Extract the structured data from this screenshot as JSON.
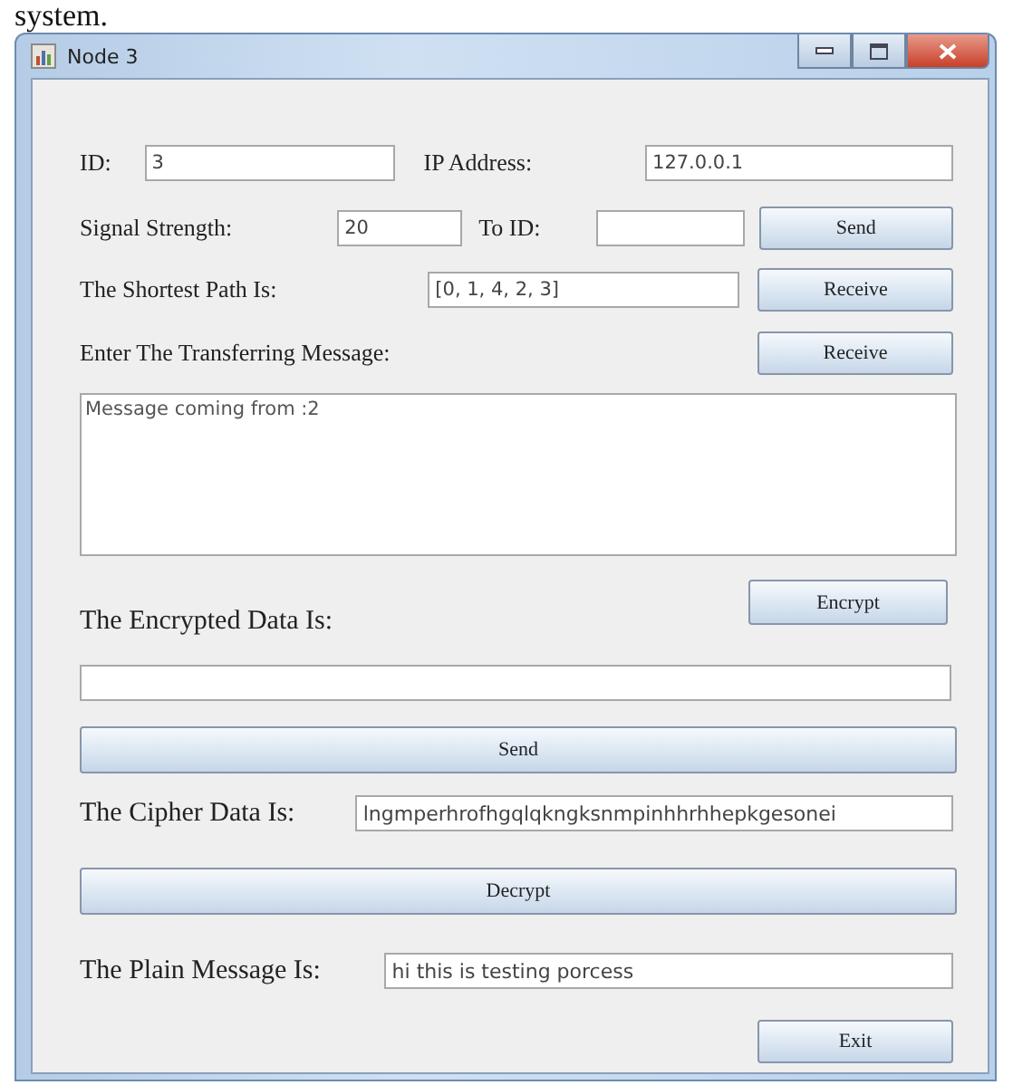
{
  "caption": "system.",
  "window": {
    "title": "Node 3"
  },
  "id": {
    "label": "ID:",
    "value": "3"
  },
  "ip_address": {
    "label": "IP Address:",
    "value": "127.0.0.1"
  },
  "signal_strength": {
    "label": "Signal Strength:",
    "value": "20"
  },
  "to_id": {
    "label": "To ID:"
  },
  "send_button": "Send",
  "shortest_path": {
    "label": "The Shortest Path Is:",
    "value": "[0, 1, 4, 2, 3]"
  },
  "receive_path_button": "Receive",
  "message": {
    "label": "Enter The Transferring Message:",
    "value": "Message coming from :2"
  },
  "receive_message_button": "Receive",
  "encrypt_button": "Encrypt",
  "encrypted_data": {
    "label": "The Encrypted Data Is:"
  },
  "send_encrypted_button": "Send",
  "cipher_data": {
    "label": "The Cipher Data Is:",
    "value": "lngmperhrofhgqlqkngksnmpinhhrhhepkgesonei"
  },
  "decrypt_button": "Decrypt",
  "plain_message": {
    "label": "The Plain Message Is:",
    "value": "hi this is testing porcess"
  },
  "exit_button": "Exit"
}
